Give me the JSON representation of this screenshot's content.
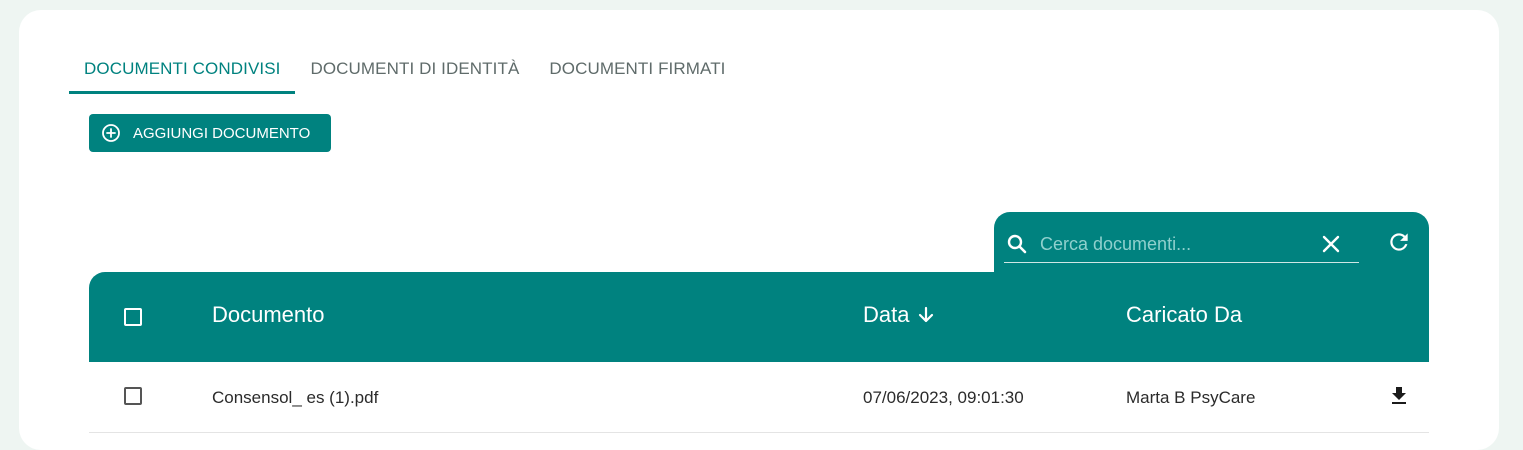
{
  "tabs": [
    {
      "label": "DOCUMENTI CONDIVISI",
      "active": true
    },
    {
      "label": "DOCUMENTI DI IDENTITÀ",
      "active": false
    },
    {
      "label": "DOCUMENTI FIRMATI",
      "active": false
    }
  ],
  "toolbar": {
    "add_label": "AGGIUNGI DOCUMENTO",
    "add_icon": "add-circle-icon"
  },
  "search": {
    "placeholder": "Cerca documenti...",
    "value": "",
    "search_icon": "search-icon",
    "clear_icon": "close-icon",
    "refresh_icon": "refresh-icon"
  },
  "table": {
    "columns": {
      "document": "Documento",
      "date": "Data",
      "uploaded_by": "Caricato Da"
    },
    "sort_icon": "arrow-down-icon",
    "rows": [
      {
        "document": "Consensol_ es (1).pdf",
        "date": "07/06/2023, 09:01:30",
        "uploaded_by": "Marta B PsyCare",
        "action_icon": "download-icon"
      }
    ]
  },
  "colors": {
    "accent": "#00827f",
    "background": "#eef5f2"
  }
}
